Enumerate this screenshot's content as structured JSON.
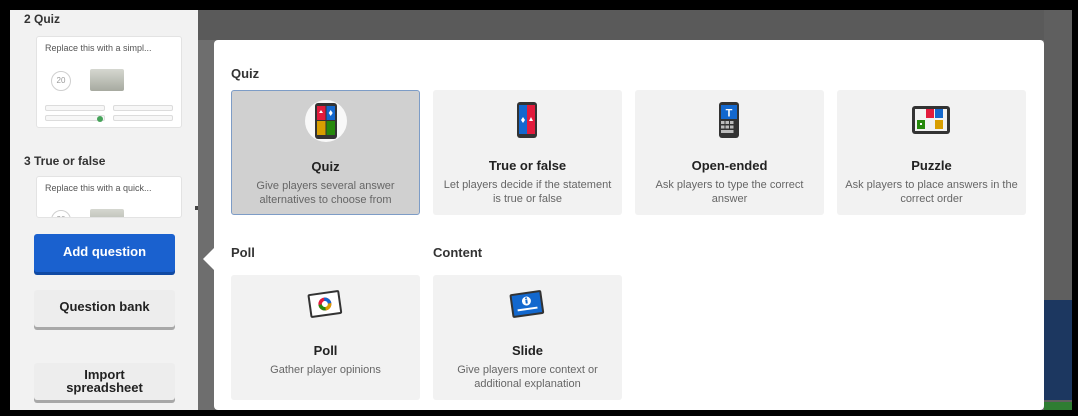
{
  "sidebar": {
    "questions": [
      {
        "heading": "2  Quiz",
        "text": "Replace this with a simpl...",
        "time": "20"
      },
      {
        "heading": "3  True or false",
        "text": "Replace this with a quick...",
        "time": "20"
      }
    ],
    "add_question": "Add question",
    "question_bank": "Question bank",
    "import_line1": "Import",
    "import_line2": "spreadsheet"
  },
  "panel": {
    "section_quiz": "Quiz",
    "section_poll": "Poll",
    "section_content": "Content",
    "tiles": [
      {
        "icon": "quiz-icon",
        "title": "Quiz",
        "desc": "Give players several answer alternatives to choose from",
        "selected": true
      },
      {
        "icon": "true-or-false-icon",
        "title": "True or false",
        "desc": "Let players decide if the statement is true or false"
      },
      {
        "icon": "open-ended-icon",
        "title": "Open-ended",
        "desc": "Ask players to type the correct answer"
      },
      {
        "icon": "puzzle-icon",
        "title": "Puzzle",
        "desc": "Ask players to place answers in the correct order"
      },
      {
        "icon": "poll-icon",
        "title": "Poll",
        "desc": "Gather player opinions"
      },
      {
        "icon": "slide-icon",
        "title": "Slide",
        "desc": "Give players more context or additional explanation"
      }
    ]
  },
  "colors": {
    "accent": "#1a61cf",
    "red": "#e21b3c",
    "blue": "#1368ce",
    "yellow": "#d89e00",
    "green": "#26890c"
  }
}
